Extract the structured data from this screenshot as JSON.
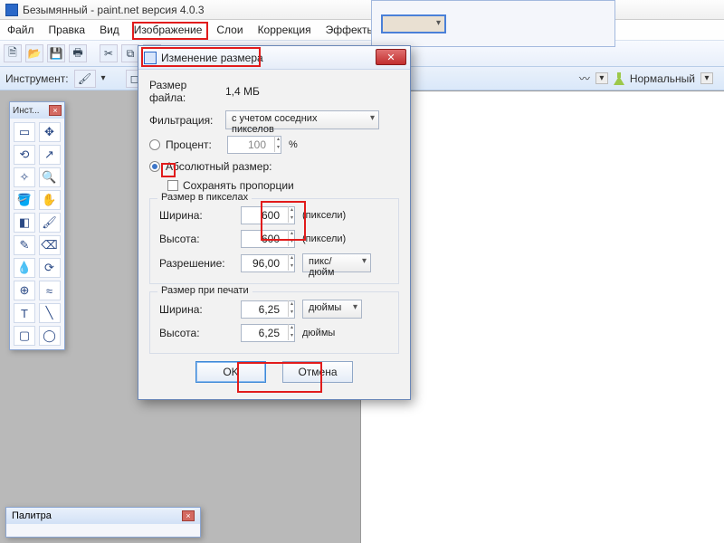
{
  "app": {
    "title": "Безымянный - paint.net версия 4.0.3",
    "menu": [
      "Файл",
      "Правка",
      "Вид",
      "Изображение",
      "Слои",
      "Коррекция",
      "Эффекты"
    ],
    "strip_label": "Инструмент:",
    "mode_label": "Нормальный"
  },
  "toolwin": {
    "title": "Инст..."
  },
  "palettewin": {
    "title": "Палитра"
  },
  "dialog": {
    "title": "Изменение размера",
    "filesize_label": "Размер файла:",
    "filesize_value": "1,4 МБ",
    "filter_label": "Фильтрация:",
    "filter_value": "с учетом соседних пикселов",
    "percent_label": "Процент:",
    "percent_value": "100",
    "percent_unit": "%",
    "absolute_label": "Абсолютный размер:",
    "keep_aspect": "Сохранять пропорции",
    "px_group": "Размер в пикселах",
    "width_label": "Ширина:",
    "height_label": "Высота:",
    "px_width": "600",
    "px_height": "600",
    "px_unit": "(пиксели)",
    "res_label": "Разрешение:",
    "res_value": "96,00",
    "res_unit": "пикс/дюйм",
    "print_group": "Размер при печати",
    "print_w": "6,25",
    "print_h": "6,25",
    "print_unit": "дюймы",
    "ok": "OK",
    "cancel": "Отмена"
  }
}
